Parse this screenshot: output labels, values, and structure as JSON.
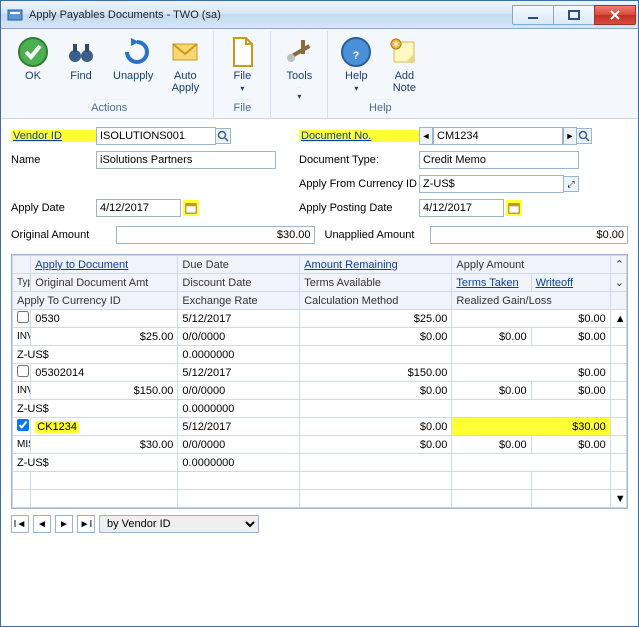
{
  "window": {
    "title": "Apply Payables Documents  -  TWO (sa)"
  },
  "ribbon": {
    "groups": {
      "actions": {
        "label": "Actions",
        "ok": "OK",
        "find": "Find",
        "unapply": "Unapply",
        "autoapply": "Auto\nApply"
      },
      "file": {
        "label": "File",
        "file": "File"
      },
      "tools": {
        "label": "",
        "tools": "Tools"
      },
      "help": {
        "label": "Help",
        "help": "Help",
        "addnote": "Add\nNote"
      }
    }
  },
  "header": {
    "vendor_id_label": "Vendor ID",
    "vendor_id": "ISOLUTIONS001",
    "name_label": "Name",
    "name": "iSolutions Partners",
    "apply_date_label": "Apply Date",
    "apply_date": "4/12/2017",
    "doc_no_label": "Document No.",
    "doc_no": "CM1234",
    "doc_type_label": "Document Type:",
    "doc_type": "Credit Memo",
    "apply_from_curr_label": "Apply From Currency ID",
    "apply_from_curr": "Z-US$",
    "apply_posting_date_label": "Apply Posting Date",
    "apply_posting_date": "4/12/2017",
    "original_amount_label": "Original Amount",
    "original_amount": "$30.00",
    "unapplied_amount_label": "Unapplied Amount",
    "unapplied_amount": "$0.00"
  },
  "grid": {
    "headers": {
      "apply_to_document": "Apply to Document",
      "due_date": "Due Date",
      "amount_remaining": "Amount Remaining",
      "apply_amount": "Apply Amount",
      "type": "Type",
      "original_document_amt": "Original Document Amt",
      "discount_date": "Discount Date",
      "terms_available": "Terms Available",
      "terms_taken": "Terms Taken",
      "writeoff": "Writeoff",
      "apply_to_currency_id": "Apply To Currency ID",
      "exchange_rate": "Exchange Rate",
      "calculation_method": "Calculation Method",
      "realized_gain_loss": "Realized Gain/Loss"
    },
    "rows": [
      {
        "checked": false,
        "highlighted": false,
        "doc": "0530",
        "due": "5/12/2017",
        "remaining": "$25.00",
        "apply_amt": "$0.00",
        "type": "INV",
        "orig_amt": "$25.00",
        "disc_date": "0/0/0000",
        "terms_avail": "$0.00",
        "terms_taken": "$0.00",
        "writeoff": "$0.00",
        "curr": "Z-US$",
        "exrate": "0.0000000",
        "calc": "",
        "gainloss": ""
      },
      {
        "checked": false,
        "highlighted": false,
        "doc": "05302014",
        "due": "5/12/2017",
        "remaining": "$150.00",
        "apply_amt": "$0.00",
        "type": "INV",
        "orig_amt": "$150.00",
        "disc_date": "0/0/0000",
        "terms_avail": "$0.00",
        "terms_taken": "$0.00",
        "writeoff": "$0.00",
        "curr": "Z-US$",
        "exrate": "0.0000000",
        "calc": "",
        "gainloss": ""
      },
      {
        "checked": true,
        "highlighted": true,
        "doc": "CK1234",
        "due": "5/12/2017",
        "remaining": "$0.00",
        "apply_amt": "$30.00",
        "type": "MIS",
        "orig_amt": "$30.00",
        "disc_date": "0/0/0000",
        "terms_avail": "$0.00",
        "terms_taken": "$0.00",
        "writeoff": "$0.00",
        "curr": "Z-US$",
        "exrate": "0.0000000",
        "calc": "",
        "gainloss": ""
      }
    ]
  },
  "footer": {
    "by_label": "by Vendor ID"
  }
}
